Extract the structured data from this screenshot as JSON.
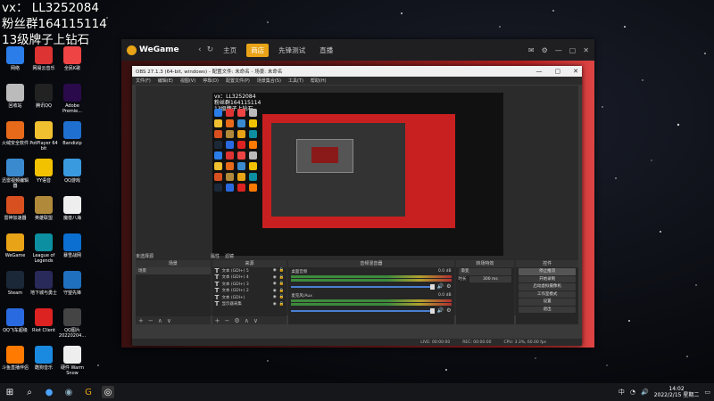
{
  "overlay": {
    "line1": "vx：  LL3252084",
    "line2": "粉丝群164115114",
    "line3": "13级牌子上钻石"
  },
  "desktop_icons": [
    {
      "label": "网络",
      "color": "#2b7de9"
    },
    {
      "label": "网易云音乐",
      "color": "#d33"
    },
    {
      "label": "全民K歌",
      "color": "#e44"
    },
    {
      "label": "回收站",
      "color": "#bbb"
    },
    {
      "label": "腾讯QQ",
      "color": "#222"
    },
    {
      "label": "Adobe Premie...",
      "color": "#2a0a4a"
    },
    {
      "label": "火绒安全软件",
      "color": "#e66a1a"
    },
    {
      "label": "PotPlayer 64 bit",
      "color": "#f0c030"
    },
    {
      "label": "Bandizip",
      "color": "#1f6fd0"
    },
    {
      "label": "迅雷视频编辑器",
      "color": "#3a8ad0"
    },
    {
      "label": "YY语音",
      "color": "#f2c200"
    },
    {
      "label": "QQ游戏",
      "color": "#3a9ae0"
    },
    {
      "label": "雷神加速器",
      "color": "#d85020"
    },
    {
      "label": "英雄联盟",
      "color": "#b08a3a"
    },
    {
      "label": "魔兽八海",
      "color": "#eee"
    },
    {
      "label": "WeGame",
      "color": "#e8a317"
    },
    {
      "label": "League of Legends",
      "color": "#0c8fa0"
    },
    {
      "label": "暴雪战网",
      "color": "#0a6fd0"
    },
    {
      "label": "Steam",
      "color": "#1b2838"
    },
    {
      "label": "地下城与勇士",
      "color": "#2a2a5a"
    },
    {
      "label": "守望先锋",
      "color": "#2070c0"
    },
    {
      "label": "QQ飞车超级",
      "color": "#2a6ae0"
    },
    {
      "label": "Riot Client",
      "color": "#d22"
    },
    {
      "label": "QQ图片20220204...",
      "color": "#444"
    },
    {
      "label": "斗鱼直播伴侣",
      "color": "#ff7a00"
    },
    {
      "label": "酷狗音乐",
      "color": "#1a8ae0"
    },
    {
      "label": "硬件 Warm Snow",
      "color": "#eee"
    }
  ],
  "wegame": {
    "logo": "WeGame",
    "tabs": [
      {
        "label": "主页",
        "active": false
      },
      {
        "label": "商店",
        "active": true
      },
      {
        "label": "先锋测试",
        "active": false
      },
      {
        "label": "直播",
        "active": false
      }
    ]
  },
  "obs": {
    "title": "OBS 27.1.3 (64-bit, windows) - 配置文件: 未命名 - 场景: 未命名",
    "menu": [
      "文件(F)",
      "编辑(E)",
      "视图(V)",
      "停靠(D)",
      "配置文件(P)",
      "场景集合(S)",
      "工具(T)",
      "帮助(H)"
    ],
    "canvas_text": [
      "vx：LL3252084",
      "粉丝群164115114",
      "13级牌子上钻石"
    ],
    "no_source": "未选择源",
    "scene_buttons": [
      "属性",
      "滤镜"
    ],
    "panels": {
      "scenes": "场景",
      "scene_item": "场景",
      "sources": "来源",
      "mixer": "音频混音器",
      "transitions": "转场特效",
      "controls": "控件"
    },
    "sources": [
      "文本 (GDI+) 5",
      "文本 (GDI+) 4",
      "文本 (GDI+) 3",
      "文本 (GDI+) 2",
      "文本 (GDI+)",
      "显示器采集"
    ],
    "mixer": [
      {
        "name": "桌面音频",
        "db": "0.0 dB"
      },
      {
        "name": "麦克风/Aux",
        "db": "0.0 dB"
      }
    ],
    "transition": {
      "type": "渐变",
      "duration_label": "时长",
      "duration": "300 ms"
    },
    "controls": [
      "停止推流",
      "开始录制",
      "启动虚拟摄像机",
      "工作室模式",
      "设置",
      "退出"
    ],
    "status": [
      "LIVE: 00:00:00",
      "REC: 00:00:00",
      "CPU: 3.3%, 60.00 fps"
    ]
  },
  "taskbar": {
    "time": "14:02",
    "date": "2022/2/15 星期二",
    "ime": "中"
  }
}
